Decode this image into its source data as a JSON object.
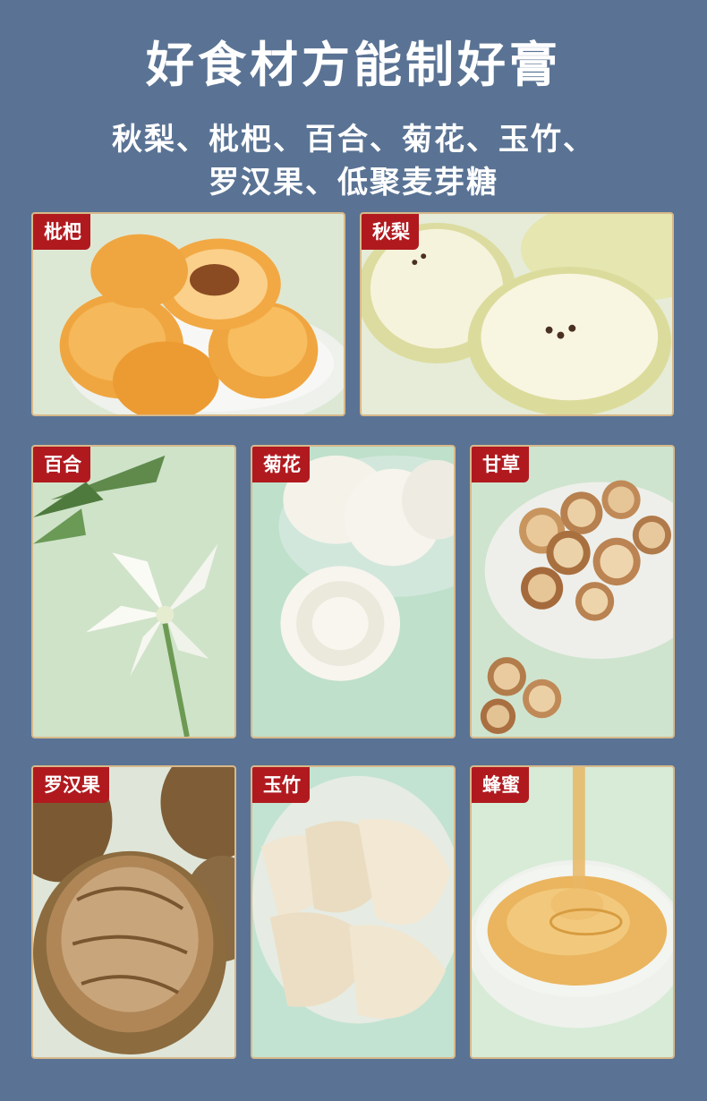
{
  "header": {
    "title": "好食材方能制好膏",
    "subtitle_line1": "秋梨、枇杷、百合、菊花、玉竹、",
    "subtitle_line2": "罗汉果、低聚麦芽糖"
  },
  "cards": [
    {
      "label": "枇杷"
    },
    {
      "label": "秋梨"
    },
    {
      "label": "百合"
    },
    {
      "label": "菊花"
    },
    {
      "label": "甘草"
    },
    {
      "label": "罗汉果"
    },
    {
      "label": "玉竹"
    },
    {
      "label": "蜂蜜"
    }
  ],
  "colors": {
    "background": "#5a7394",
    "tag": "#b01a1f",
    "card_border": "#d7b98a"
  }
}
